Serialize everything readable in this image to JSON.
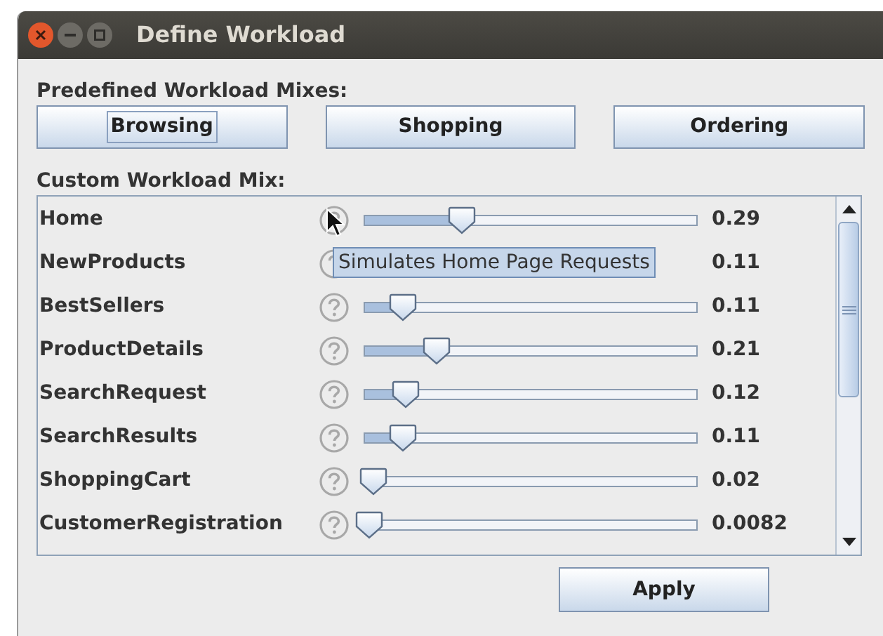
{
  "window": {
    "title": "Define Workload"
  },
  "predefined": {
    "label": "Predefined Workload Mixes:",
    "buttons": [
      {
        "label": "Browsing",
        "focused": true
      },
      {
        "label": "Shopping",
        "focused": false
      },
      {
        "label": "Ordering",
        "focused": false
      }
    ]
  },
  "custom": {
    "label": "Custom Workload Mix:",
    "rows": [
      {
        "name": "Home",
        "level": 0.29,
        "reading": "0.29"
      },
      {
        "name": "NewProducts",
        "reading": "0.11"
      },
      {
        "name": "BestSellers",
        "level": 0.11,
        "reading": "0.11"
      },
      {
        "name": "ProductDetails",
        "level": 0.21,
        "reading": "0.21"
      },
      {
        "name": "SearchRequest",
        "level": 0.12,
        "reading": "0.12"
      },
      {
        "name": "SearchResults",
        "level": 0.11,
        "reading": "0.11"
      },
      {
        "name": "ShoppingCart",
        "level": 0.02,
        "reading": "0.02"
      },
      {
        "name": "CustomerRegistration",
        "level": 0.008,
        "reading": "0.0082"
      }
    ]
  },
  "tooltip": {
    "text": "Simulates Home Page Requests"
  },
  "apply_button": "Apply"
}
